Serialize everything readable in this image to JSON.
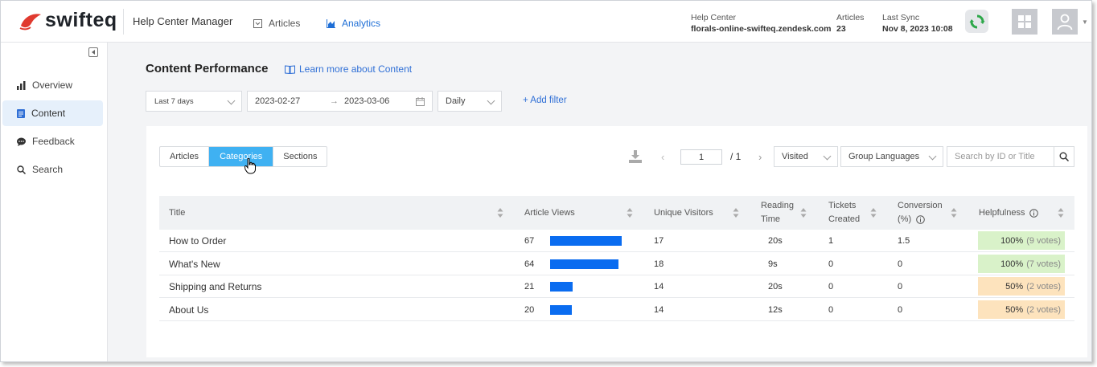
{
  "brand": {
    "name": "swifteq",
    "logo_color": "#e03a2f"
  },
  "header": {
    "app_title": "Help Center Manager",
    "nav": [
      {
        "label": "Articles",
        "active": false
      },
      {
        "label": "Analytics",
        "active": true
      }
    ],
    "help_center": {
      "label": "Help Center",
      "value": "florals-online-swifteq.zendesk.com"
    },
    "articles": {
      "label": "Articles",
      "value": "23"
    },
    "last_sync": {
      "label": "Last Sync",
      "value": "Nov 8, 2023 10:08"
    }
  },
  "sidebar": {
    "items": [
      {
        "label": "Overview",
        "icon": "bar-chart-icon",
        "active": false
      },
      {
        "label": "Content",
        "icon": "document-icon",
        "active": true
      },
      {
        "label": "Feedback",
        "icon": "chat-bubble-icon",
        "active": false
      },
      {
        "label": "Search",
        "icon": "search-icon",
        "active": false
      }
    ]
  },
  "main": {
    "title": "Content Performance",
    "learn_more": "Learn more about Content",
    "filters": {
      "range": "Last 7 days",
      "date_start": "2023-02-27",
      "date_end": "2023-03-06",
      "granularity": "Daily",
      "add_filter": "+ Add filter"
    },
    "tabs": [
      {
        "label": "Articles",
        "active": false
      },
      {
        "label": "Categories",
        "active": true
      },
      {
        "label": "Sections",
        "active": false
      }
    ],
    "pagination": {
      "current": "1",
      "total": "/ 1"
    },
    "sort_select": "Visited",
    "language_select": "Group Languages",
    "search_placeholder": "Search by ID or Title",
    "columns": {
      "title": "Title",
      "views": "Article Views",
      "visitors": "Unique Visitors",
      "reading_line1": "Reading",
      "reading_line2": "Time",
      "tickets_line1": "Tickets",
      "tickets_line2": "Created",
      "conversion_line1": "Conversion",
      "conversion_line2": "(%)",
      "helpfulness": "Helpfulness"
    },
    "rows": [
      {
        "title": "How to Order",
        "views": "67",
        "views_fraction": 1.0,
        "visitors": "17",
        "reading": "20s",
        "tickets": "1",
        "conversion": "1.5",
        "helpful": "100%",
        "votes": "(9 votes)",
        "help_color": "#d9f2c9"
      },
      {
        "title": "What's New",
        "views": "64",
        "views_fraction": 0.955,
        "visitors": "18",
        "reading": "9s",
        "tickets": "0",
        "conversion": "0",
        "helpful": "100%",
        "votes": "(7 votes)",
        "help_color": "#d9f2c9"
      },
      {
        "title": "Shipping and Returns",
        "views": "21",
        "views_fraction": 0.313,
        "visitors": "14",
        "reading": "20s",
        "tickets": "0",
        "conversion": "0",
        "helpful": "50%",
        "votes": "(2 votes)",
        "help_color": "#fde3bd"
      },
      {
        "title": "About Us",
        "views": "20",
        "views_fraction": 0.298,
        "visitors": "14",
        "reading": "12s",
        "tickets": "0",
        "conversion": "0",
        "helpful": "50%",
        "votes": "(2 votes)",
        "help_color": "#fde3bd"
      }
    ]
  },
  "colors": {
    "accent": "#1f6fd6",
    "tab_active": "#3fb1f2",
    "bar": "#0a6cf0",
    "sync_green": "#2ea84a"
  }
}
